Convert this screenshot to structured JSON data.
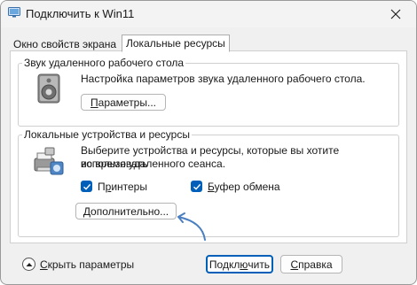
{
  "window": {
    "title": "Подключить к Win11"
  },
  "tabs": [
    {
      "label": "Окно свойств экрана",
      "active": false
    },
    {
      "label": "Локальные ресурсы",
      "active": true
    }
  ],
  "sound_group": {
    "title": "Звук удаленного рабочего стола",
    "description": "Настройка параметров звука удаленного рабочего стола.",
    "button_label_pre": "",
    "button_label_u": "П",
    "button_label_post": "араметры...",
    "icon": "speaker-icon"
  },
  "devices_group": {
    "title": "Локальные устройства и ресурсы",
    "description_line1": "Выберите устройства и ресурсы, которые вы хотите использовать",
    "description_line2": "во время удаленного сеанса.",
    "icon": "devices-icon",
    "checkboxes": [
      {
        "label_pre": "П",
        "label_u": "р",
        "label_post": "интеры",
        "checked": true
      },
      {
        "label_pre": "",
        "label_u": "Б",
        "label_post": "уфер обмена",
        "checked": true
      }
    ],
    "more_button_pre": "",
    "more_button_u": "Д",
    "more_button_post": "ополнительно..."
  },
  "footer": {
    "toggle_label_pre": "",
    "toggle_label_u": "С",
    "toggle_label_post": "крыть параметры",
    "connect_pre": "Подкл",
    "connect_u": "ю",
    "connect_post": "чить",
    "help_pre": "",
    "help_u": "С",
    "help_post": "правка"
  },
  "colors": {
    "accent": "#005fb8",
    "annotation": "#4a7fc1"
  }
}
